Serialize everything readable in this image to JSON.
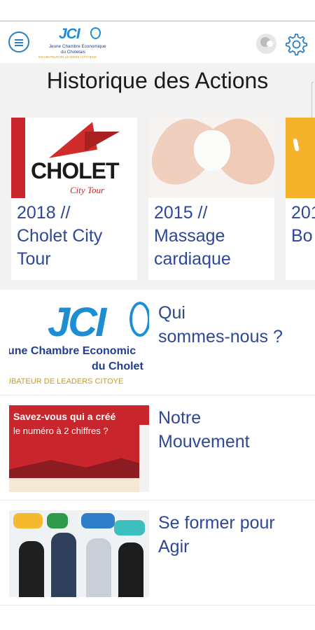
{
  "header": {
    "logo": {
      "brand": "JCI",
      "line1": "Jeune Chambre Economique",
      "line2": "du Choletais",
      "line3": "INCUBATEUR DE LEADERS CITOYENS"
    },
    "menu_icon": "menu-icon",
    "profile_icon": "profile-icon",
    "settings_icon": "gear-icon"
  },
  "history": {
    "title": "Historique des Actions",
    "cards": [
      {
        "line1": "2018 //",
        "line2": "Cholet City",
        "line3": "Tour",
        "image_text": "CHOLET",
        "image_subtext": "City Tour"
      },
      {
        "line1": "2015 //",
        "line2": "Massage",
        "line3": "cardiaque"
      },
      {
        "line1": "201",
        "line2": "Bo",
        "line3": ""
      }
    ]
  },
  "rows": [
    {
      "label_line1": "Qui",
      "label_line2": "sommes-nous ?",
      "image_brand": "JCI",
      "image_line1": "une Chambre Economic",
      "image_line2": "du Cholet",
      "image_line3": "UBATEUR DE LEADERS CITOYE"
    },
    {
      "label_line1": "Notre",
      "label_line2": "Mouvement",
      "image_line1": "Savez-vous qui a créé",
      "image_line2": "le numéro à 2 chiffres ?"
    },
    {
      "label_line1": "Se former pour",
      "label_line2": "Agir"
    }
  ],
  "colors": {
    "accent": "#2d7fc1",
    "text_blue": "#2e4799",
    "brand_red": "#c9252c",
    "section_bg": "#f2f2f2"
  }
}
